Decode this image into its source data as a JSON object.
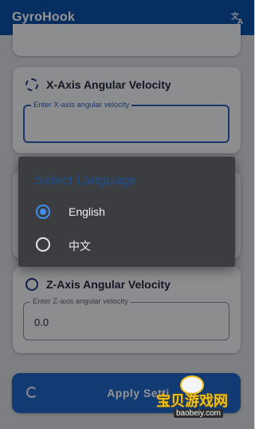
{
  "appbar": {
    "title": "GyroHook",
    "language_icon": "translate-icon"
  },
  "x_axis": {
    "label": "X-Axis Angular Velocity",
    "placeholder": "Enter X-axis angular velocity",
    "value": ""
  },
  "z_axis": {
    "label": "Z-Axis Angular Velocity",
    "placeholder": "Enter Z-axis angular velocity",
    "value": "0.0"
  },
  "apply_button": {
    "label": "Apply Setti"
  },
  "dialog": {
    "title": "Select Language",
    "options": [
      {
        "label": "English",
        "selected": true
      },
      {
        "label": "中文",
        "selected": false
      }
    ]
  },
  "watermark": {
    "text": "宝贝游戏网",
    "url": "baobeiy.com"
  },
  "colors": {
    "primary": "#0b50a8",
    "accent": "#3f8ff0",
    "dialog_bg": "#3c3d40"
  }
}
